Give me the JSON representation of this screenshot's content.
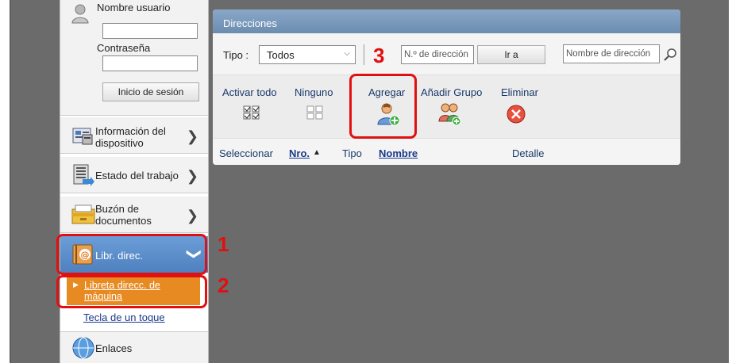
{
  "login": {
    "username_label": "Nombre usuario",
    "password_label": "Contraseña",
    "username_value": "",
    "password_value": "",
    "login_button": "Inicio de sesión"
  },
  "sidebar": {
    "items": [
      {
        "label_line1": "Información del",
        "label_line2": "dispositivo"
      },
      {
        "label": "Estado del trabajo"
      },
      {
        "label_line1": "Buzón de",
        "label_line2": "documentos"
      },
      {
        "label": "Libr. direc."
      }
    ],
    "sub_active_line1": "Libreta direcc. de",
    "sub_active_line2": "máquina",
    "sub_other": "Tecla de un toque",
    "links": "Enlaces"
  },
  "panel": {
    "title": "Direcciones",
    "tipo_label": "Tipo :",
    "tipo_value": "Todos",
    "num_placeholder": "N.º de dirección",
    "go_button": "Ir a",
    "name_placeholder": "Nombre de dirección",
    "toolbar": {
      "activate_all": "Activar todo",
      "none": "Ninguno",
      "add": "Agregar",
      "add_group": "Añadir Grupo",
      "delete": "Eliminar"
    },
    "columns": {
      "select": "Seleccionar",
      "number": "Nro.",
      "type": "Tipo",
      "name": "Nombre",
      "detail": "Detalle"
    }
  },
  "steps": {
    "one": "1",
    "two": "2",
    "three": "3"
  },
  "colors": {
    "highlight": "#e01010",
    "active_item": "#e88a22",
    "selected_item": "#5a8cc9"
  }
}
